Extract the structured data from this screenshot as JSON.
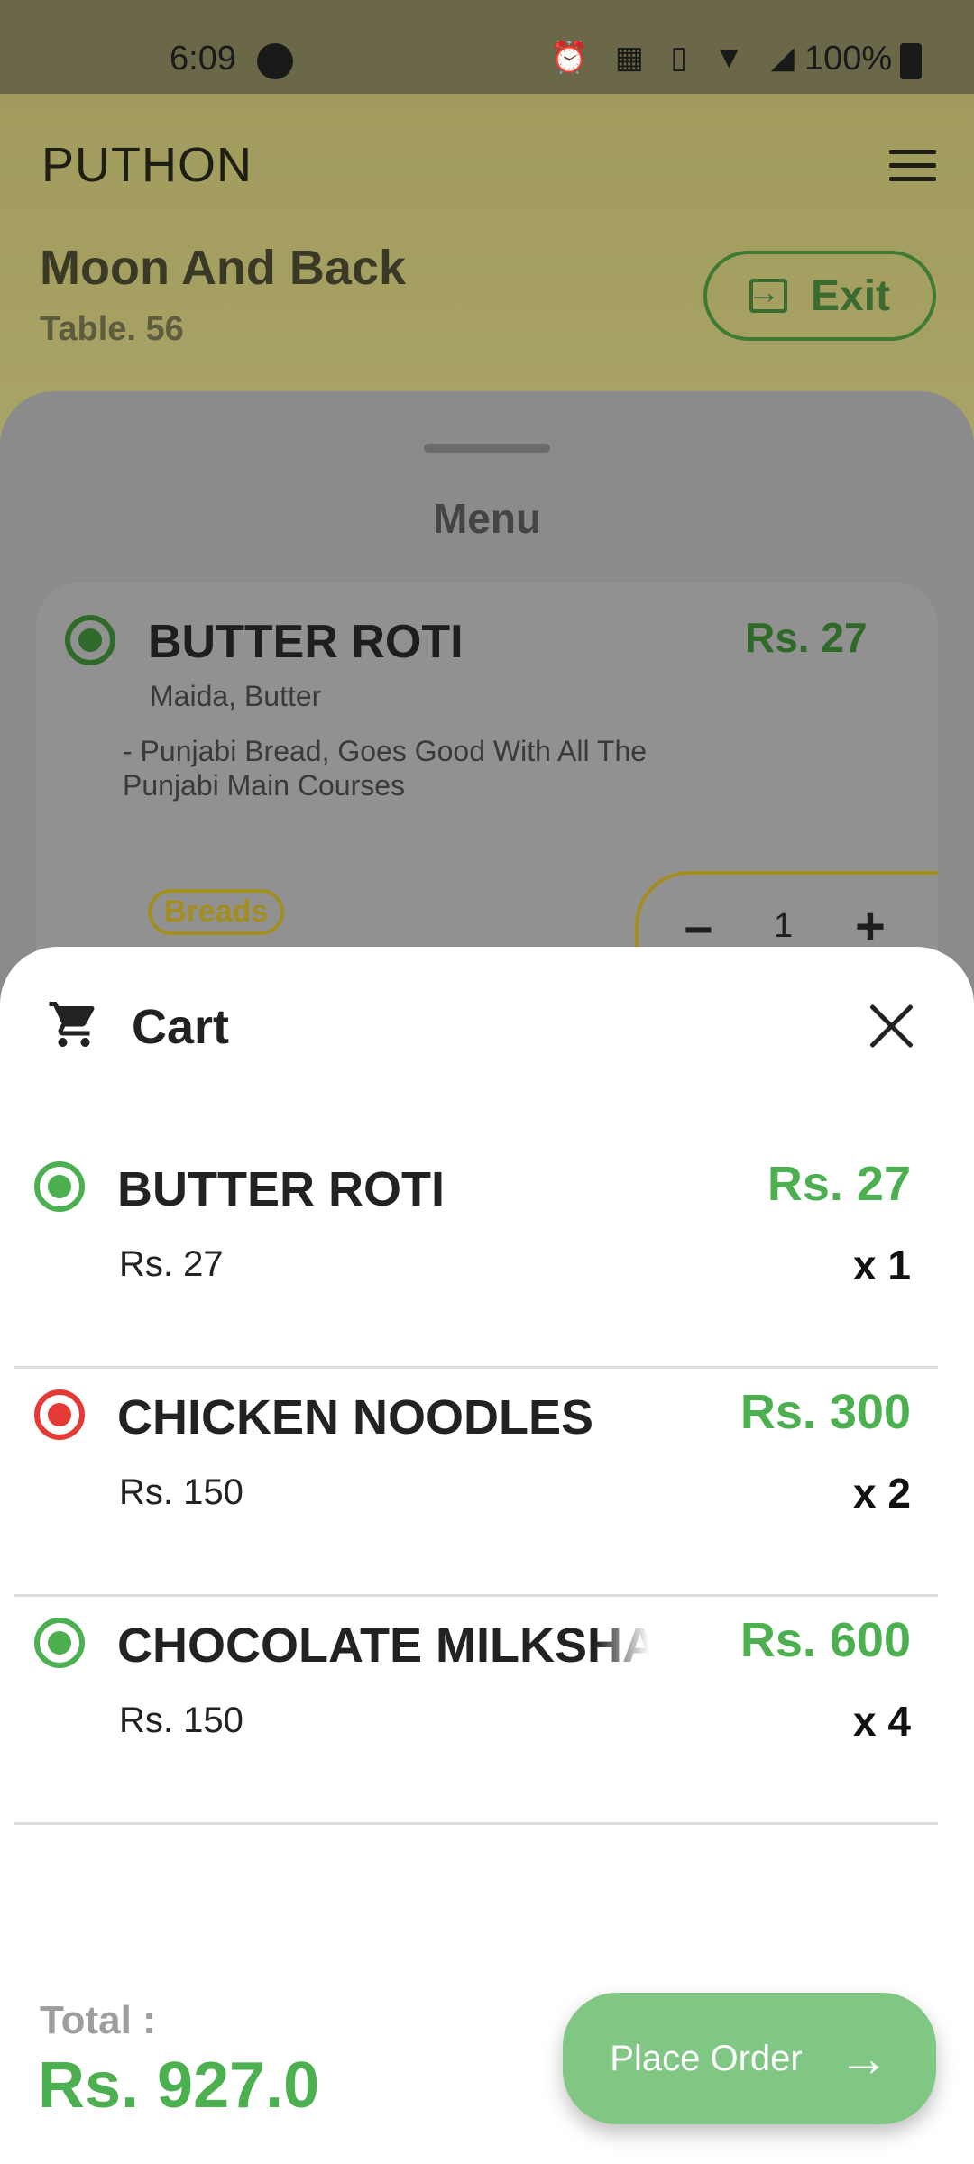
{
  "status_bar": {
    "time": "6:09",
    "battery_pct": "100%"
  },
  "app": {
    "brand": "PUTHON",
    "restaurant": "Moon And Back",
    "table": "Table. 56",
    "exit_label": "Exit"
  },
  "menu": {
    "title": "Menu",
    "item": {
      "name": "BUTTER ROTI",
      "price": "Rs. 27",
      "ingredients": "Maida, Butter",
      "description": "-  Punjabi Bread, Goes Good With All The Punjabi Main Courses",
      "category": "Breads",
      "qty": "1"
    }
  },
  "cart": {
    "title": "Cart",
    "items": [
      {
        "name": "BUTTER ROTI",
        "total": "Rs. 27",
        "unit_price": "Rs. 27",
        "qty": "x 1",
        "type": "veg"
      },
      {
        "name": "CHICKEN NOODLES",
        "total": "Rs. 300",
        "unit_price": "Rs. 150",
        "qty": "x 2",
        "type": "non-veg"
      },
      {
        "name": "CHOCOLATE MILKSHAKE",
        "total": "Rs. 600",
        "unit_price": "Rs. 150",
        "qty": "x 4",
        "type": "veg"
      }
    ],
    "total_label": "Total :",
    "total_value": "Rs. 927.0",
    "place_order_label": "Place Order"
  },
  "colors": {
    "accent_green": "#4caf50",
    "button_green": "#81c784",
    "nonveg_red": "#e53935",
    "tag_gold": "#a38d1e"
  }
}
